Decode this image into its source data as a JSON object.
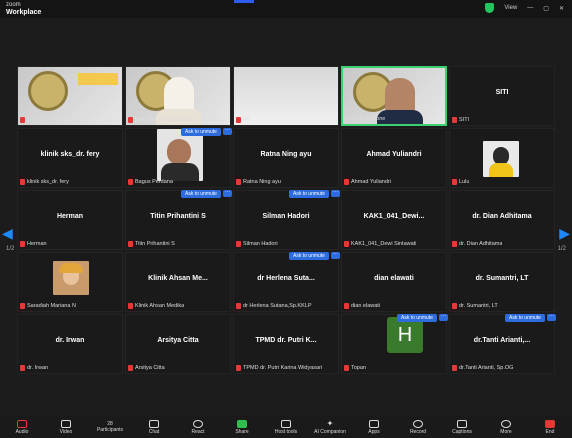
{
  "app": {
    "brand_top": "zoom",
    "brand_bottom": "Workplace",
    "view_label": "View"
  },
  "page": {
    "left": "1/2",
    "right": "1/2"
  },
  "ask_label": "Ask to unmute",
  "more_label": "···",
  "avatar_letter": "H",
  "tiles": [
    {
      "name": "",
      "label": "070_Jumy Ardeena"
    },
    {
      "name": "",
      "label": "Kakai DLP Bengkulu dan Lampung"
    },
    {
      "name": "",
      "label": "Fir"
    },
    {
      "name": "",
      "label": "Fuad A. anthone"
    },
    {
      "name": "SITI",
      "label": "SITI"
    },
    {
      "name": "klinik sks_dr. fery",
      "label": "klinik sks_dr. fery"
    },
    {
      "name": "",
      "label": "Bagus Perdana"
    },
    {
      "name": "Ratna Ning ayu",
      "label": "Ratna Ning ayu"
    },
    {
      "name": "Ahmad Yuliandri",
      "label": "Ahmad Yuliandri"
    },
    {
      "name": "",
      "label": "Lulu"
    },
    {
      "name": "Herman",
      "label": "Herman"
    },
    {
      "name": "Titin Prihantini S",
      "label": "Titin Prihantini S"
    },
    {
      "name": "Silman Hadori",
      "label": "Silman Hadori"
    },
    {
      "name": "KAK1_041_Dewi...",
      "label": "KAK1_041_Dewi Sintawati"
    },
    {
      "name": "dr. Dian Adhitama",
      "label": "dr. Dian Adhitama"
    },
    {
      "name": "",
      "label": "Saradiah Mariana N"
    },
    {
      "name": "Klinik Ahsan Me...",
      "label": "Klinik Ahsan Medika"
    },
    {
      "name": "dr Herlena Suta...",
      "label": "dr Herlena Sutana,Sp.KKLP"
    },
    {
      "name": "dian elawati",
      "label": "dian elawati"
    },
    {
      "name": "dr. Sumantri, LT",
      "label": "dr. Sumantri, LT"
    },
    {
      "name": "dr. Irwan",
      "label": "dr. Irwan"
    },
    {
      "name": "Arsitya Citta",
      "label": "Arsitya Citta"
    },
    {
      "name": "TPMD dr. Putri K...",
      "label": "TPMD dr. Putri Karina Widyasari"
    },
    {
      "name": "",
      "label": "Topan"
    },
    {
      "name": "dr.Tanti Arianti,...",
      "label": "dr.Tanti Arianti, Sp.OG"
    }
  ],
  "toolbar": [
    {
      "label": "Audio"
    },
    {
      "label": "Video"
    },
    {
      "label": "Participants",
      "count": "28"
    },
    {
      "label": "Chat"
    },
    {
      "label": "React"
    },
    {
      "label": "Share"
    },
    {
      "label": "Host tools"
    },
    {
      "label": "AI Companion"
    },
    {
      "label": "Apps"
    },
    {
      "label": "Record"
    },
    {
      "label": "Captions"
    },
    {
      "label": "More"
    },
    {
      "label": "End"
    }
  ]
}
